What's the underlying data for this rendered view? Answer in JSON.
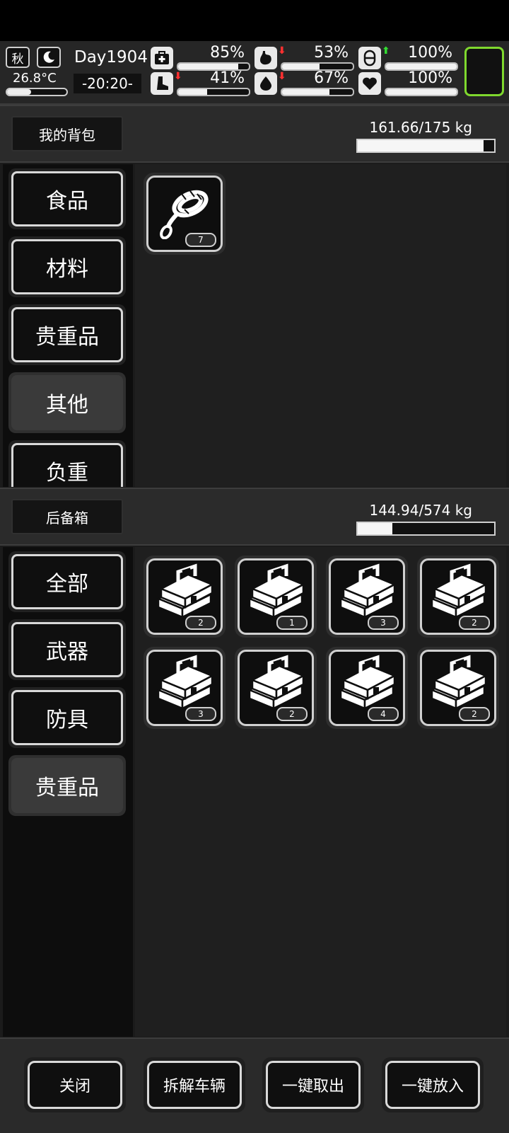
{
  "status": {
    "season": "秋",
    "temperature": "26.8°C",
    "day": "Day1904",
    "time": "-20:20-",
    "stats": [
      {
        "name": "health",
        "icon": "medkit-icon",
        "value": "85%",
        "level": 0.85,
        "trend": ""
      },
      {
        "name": "hunger",
        "icon": "stomach-icon",
        "value": "53%",
        "level": 0.53,
        "trend": "down"
      },
      {
        "name": "energy",
        "icon": "capsule-icon",
        "value": "100%",
        "level": 1.0,
        "trend": "up"
      },
      {
        "name": "stamina",
        "icon": "boot-icon",
        "value": "41%",
        "level": 0.41,
        "trend": "down"
      },
      {
        "name": "thirst",
        "icon": "water-drop-icon",
        "value": "67%",
        "level": 0.67,
        "trend": "down"
      },
      {
        "name": "mood",
        "icon": "heart-icon",
        "value": "100%",
        "level": 1.0,
        "trend": ""
      }
    ]
  },
  "backpack": {
    "title": "我的背包",
    "weight_text": "161.66/175 kg",
    "fill": 0.924,
    "tabs": [
      "食品",
      "材料",
      "贵重品",
      "其他",
      "负重"
    ],
    "active_tab": 3,
    "items": [
      {
        "icon": "rope-icon",
        "count": "7"
      }
    ]
  },
  "trunk": {
    "title": "后备箱",
    "weight_text": "144.94/574 kg",
    "fill": 0.253,
    "tabs": [
      "全部",
      "武器",
      "防具",
      "贵重品"
    ],
    "active_tab": 3,
    "items": [
      {
        "icon": "toolbox-icon",
        "count": "2"
      },
      {
        "icon": "toolbox-icon",
        "count": "1"
      },
      {
        "icon": "toolbox-icon",
        "count": "3"
      },
      {
        "icon": "toolbox-icon",
        "count": "2"
      },
      {
        "icon": "toolbox-icon",
        "count": "3"
      },
      {
        "icon": "toolbox-icon",
        "count": "2"
      },
      {
        "icon": "toolbox-icon",
        "count": "4"
      },
      {
        "icon": "toolbox-icon",
        "count": "2"
      }
    ]
  },
  "footer": {
    "buttons": [
      "关闭",
      "拆解车辆",
      "一键取出",
      "一键放入"
    ]
  }
}
